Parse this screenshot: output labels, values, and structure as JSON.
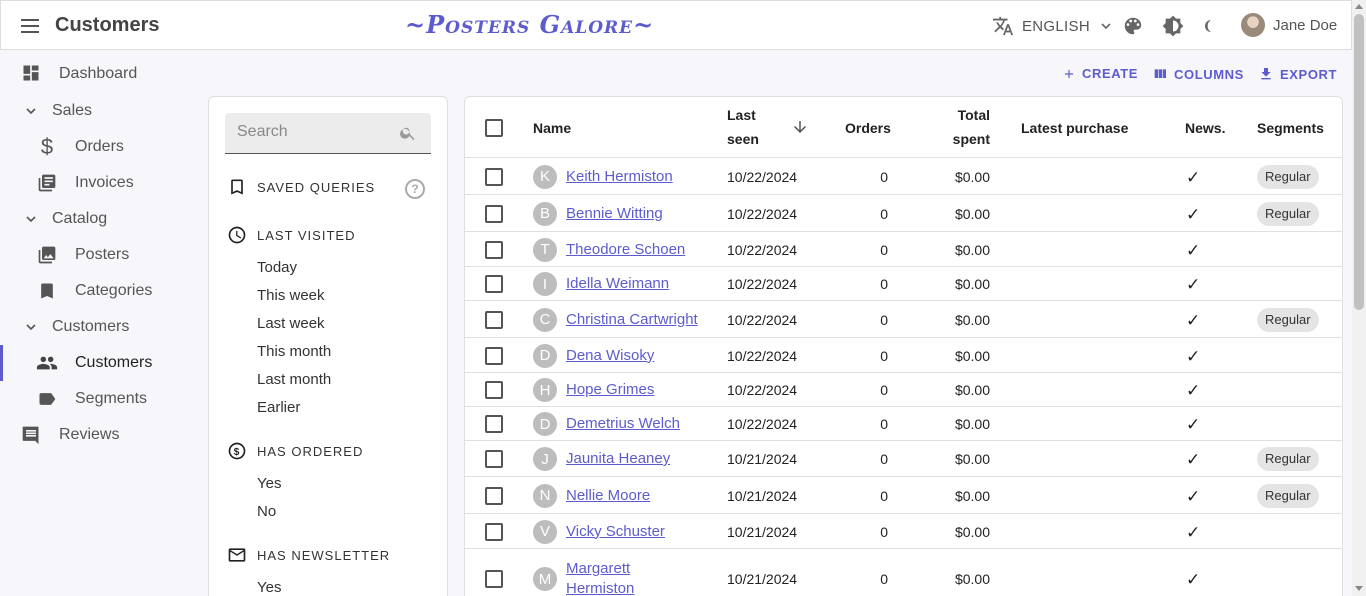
{
  "app": {
    "title": "Customers",
    "brand": "~Posters Galore~",
    "language": "ENGLISH",
    "user_name": "Jane Doe",
    "accent_color": "#5c5ccf"
  },
  "sidebar": {
    "items": [
      {
        "label": "Dashboard",
        "icon": "dashboard-icon"
      },
      {
        "label": "Sales",
        "icon": "chevron-down-icon"
      },
      {
        "label": "Orders",
        "icon": "dollar-icon"
      },
      {
        "label": "Invoices",
        "icon": "invoice-icon"
      },
      {
        "label": "Catalog",
        "icon": "chevron-down-icon"
      },
      {
        "label": "Posters",
        "icon": "image-icon"
      },
      {
        "label": "Categories",
        "icon": "bookmark-icon"
      },
      {
        "label": "Customers",
        "icon": "chevron-down-icon"
      },
      {
        "label": "Customers",
        "icon": "people-icon"
      },
      {
        "label": "Segments",
        "icon": "label-icon"
      },
      {
        "label": "Reviews",
        "icon": "comment-icon"
      }
    ]
  },
  "toolbar": {
    "create": "CREATE",
    "columns": "COLUMNS",
    "export": "EXPORT"
  },
  "filters": {
    "search_placeholder": "Search",
    "saved_queries": "SAVED QUERIES",
    "last_visited": {
      "title": "LAST VISITED",
      "options": [
        "Today",
        "This week",
        "Last week",
        "This month",
        "Last month",
        "Earlier"
      ]
    },
    "has_ordered": {
      "title": "HAS ORDERED",
      "options": [
        "Yes",
        "No"
      ]
    },
    "has_newsletter": {
      "title": "HAS NEWSLETTER",
      "options": [
        "Yes"
      ]
    }
  },
  "table": {
    "headers": {
      "name": "Name",
      "last_seen_1": "Last",
      "last_seen_2": "seen",
      "orders": "Orders",
      "total_1": "Total",
      "total_2": "spent",
      "latest_purchase": "Latest purchase",
      "news": "News.",
      "segments": "Segments"
    },
    "rows": [
      {
        "initial": "K",
        "name": "Keith Hermiston",
        "last_seen": "10/22/2024",
        "orders": "0",
        "total": "$0.00",
        "news": "✓",
        "segment": "Regular"
      },
      {
        "initial": "B",
        "name": "Bennie Witting",
        "last_seen": "10/22/2024",
        "orders": "0",
        "total": "$0.00",
        "news": "✓",
        "segment": "Regular"
      },
      {
        "initial": "T",
        "name": "Theodore Schoen",
        "last_seen": "10/22/2024",
        "orders": "0",
        "total": "$0.00",
        "news": "✓",
        "segment": ""
      },
      {
        "initial": "I",
        "name": "Idella Weimann",
        "last_seen": "10/22/2024",
        "orders": "0",
        "total": "$0.00",
        "news": "✓",
        "segment": ""
      },
      {
        "initial": "C",
        "name": "Christina Cartwright",
        "last_seen": "10/22/2024",
        "orders": "0",
        "total": "$0.00",
        "news": "✓",
        "segment": "Regular"
      },
      {
        "initial": "D",
        "name": "Dena Wisoky",
        "last_seen": "10/22/2024",
        "orders": "0",
        "total": "$0.00",
        "news": "✓",
        "segment": ""
      },
      {
        "initial": "H",
        "name": "Hope Grimes",
        "last_seen": "10/22/2024",
        "orders": "0",
        "total": "$0.00",
        "news": "✓",
        "segment": ""
      },
      {
        "initial": "D",
        "name": "Demetrius Welch",
        "last_seen": "10/22/2024",
        "orders": "0",
        "total": "$0.00",
        "news": "✓",
        "segment": ""
      },
      {
        "initial": "J",
        "name": "Jaunita Heaney",
        "last_seen": "10/21/2024",
        "orders": "0",
        "total": "$0.00",
        "news": "✓",
        "segment": "Regular"
      },
      {
        "initial": "N",
        "name": "Nellie Moore",
        "last_seen": "10/21/2024",
        "orders": "0",
        "total": "$0.00",
        "news": "✓",
        "segment": "Regular"
      },
      {
        "initial": "V",
        "name": "Vicky Schuster",
        "last_seen": "10/21/2024",
        "orders": "0",
        "total": "$0.00",
        "news": "✓",
        "segment": ""
      },
      {
        "initial": "M",
        "name": "Margarett Hermiston",
        "last_seen": "10/21/2024",
        "orders": "0",
        "total": "$0.00",
        "news": "✓",
        "segment": ""
      }
    ]
  }
}
